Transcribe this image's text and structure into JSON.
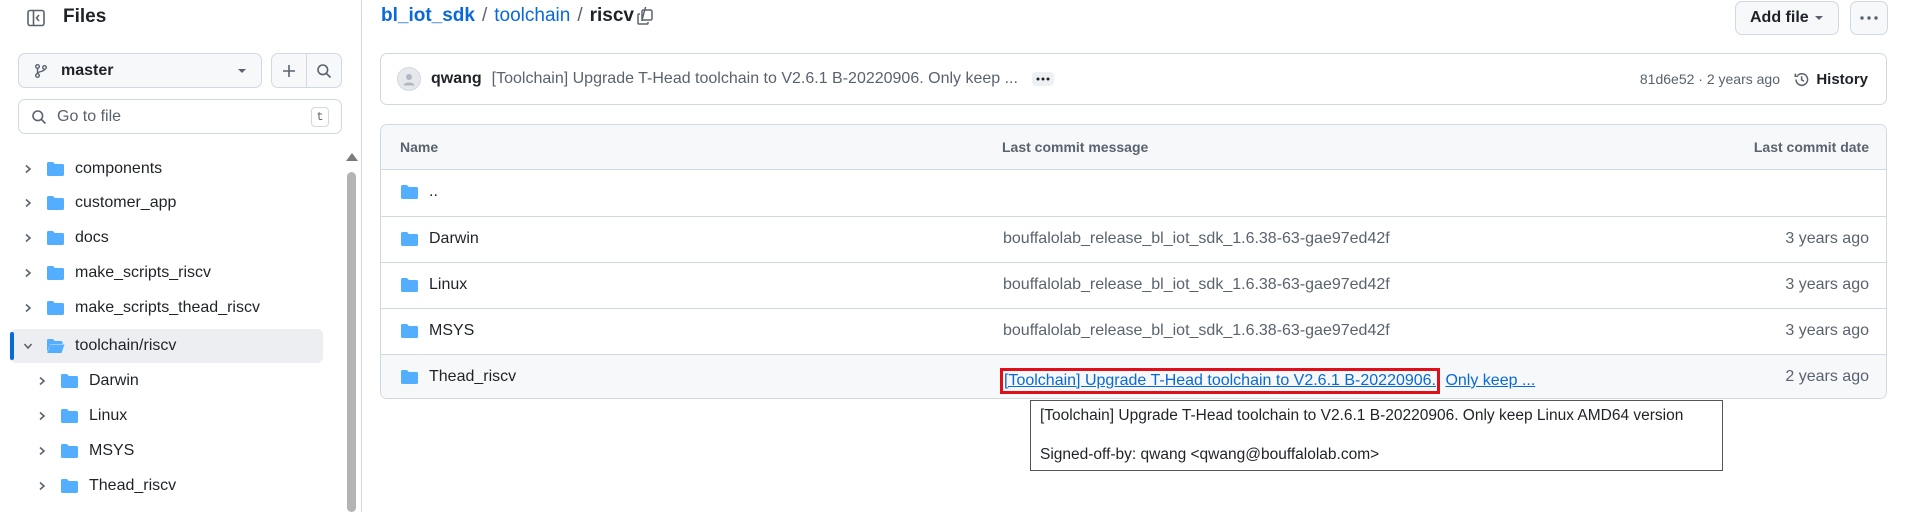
{
  "sidebar": {
    "title": "Files",
    "branch": "master",
    "search_placeholder": "Go to file",
    "search_shortcut": "t",
    "tree": [
      {
        "label": "components",
        "level": 0,
        "expanded": false,
        "active": false
      },
      {
        "label": "customer_app",
        "level": 0,
        "expanded": false,
        "active": false
      },
      {
        "label": "docs",
        "level": 0,
        "expanded": false,
        "active": false
      },
      {
        "label": "make_scripts_riscv",
        "level": 0,
        "expanded": false,
        "active": false
      },
      {
        "label": "make_scripts_thead_riscv",
        "level": 0,
        "expanded": false,
        "active": false
      },
      {
        "label": "toolchain/riscv",
        "level": 0,
        "expanded": true,
        "active": true
      },
      {
        "label": "Darwin",
        "level": 1,
        "expanded": false,
        "active": false
      },
      {
        "label": "Linux",
        "level": 1,
        "expanded": false,
        "active": false
      },
      {
        "label": "MSYS",
        "level": 1,
        "expanded": false,
        "active": false
      },
      {
        "label": "Thead_riscv",
        "level": 1,
        "expanded": false,
        "active": false
      }
    ]
  },
  "header": {
    "breadcrumb": {
      "repo": "bl_iot_sdk",
      "sep1": "/",
      "dir": "toolchain",
      "sep2": "/",
      "current": "riscv",
      "sep3": "/"
    },
    "add_file_label": "Add file"
  },
  "commit": {
    "author": "qwang",
    "message": "[Toolchain] Upgrade T-Head toolchain to V2.6.1 B-20220906. Only keep ...",
    "meta": "81d6e52 · 2 years ago",
    "history_label": "History"
  },
  "table": {
    "headers": {
      "name": "Name",
      "message": "Last commit message",
      "date": "Last commit date"
    },
    "parent_label": "..",
    "rows": [
      {
        "name": "Darwin",
        "message": "bouffalolab_release_bl_iot_sdk_1.6.38-63-gae97ed42f",
        "date": "3 years ago"
      },
      {
        "name": "Linux",
        "message": "bouffalolab_release_bl_iot_sdk_1.6.38-63-gae97ed42f",
        "date": "3 years ago"
      },
      {
        "name": "MSYS",
        "message": "bouffalolab_release_bl_iot_sdk_1.6.38-63-gae97ed42f",
        "date": "3 years ago"
      },
      {
        "name": "Thead_riscv",
        "message_part1": "[Toolchain] Upgrade T-Head toolchain to V2.6.1 B-20220906.",
        "message_part2": "Only keep ...",
        "date": "2 years ago"
      }
    ]
  },
  "tooltip": {
    "line1": "[Toolchain] Upgrade T-Head toolchain to V2.6.1 B-20220906. Only keep Linux AMD64 version",
    "line2": "Signed-off-by: qwang <qwang@bouffalolab.com>"
  },
  "colors": {
    "accent": "#0969da",
    "folder": "#54aeff",
    "highlight": "#e0101a"
  }
}
